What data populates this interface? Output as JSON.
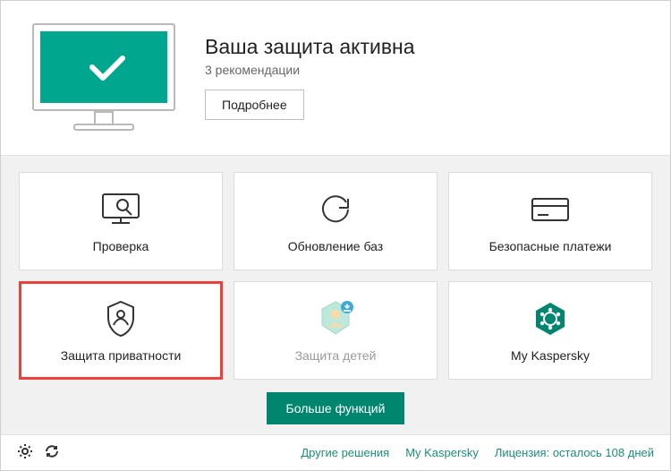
{
  "header": {
    "title": "Ваша защита активна",
    "subtitle": "3 рекомендации",
    "details_button": "Подробнее"
  },
  "tiles": {
    "scan": "Проверка",
    "update": "Обновление баз",
    "safe_money": "Безопасные платежи",
    "privacy": "Защита приватности",
    "kids": "Защита детей",
    "mykaspersky": "My Kaspersky"
  },
  "more_button": "Больше функций",
  "footer": {
    "other_solutions": "Другие решения",
    "my_kaspersky": "My Kaspersky",
    "license": "Лицензия: осталось 108 дней"
  },
  "colors": {
    "accent": "#00866e",
    "highlight": "#ef3f3a"
  }
}
